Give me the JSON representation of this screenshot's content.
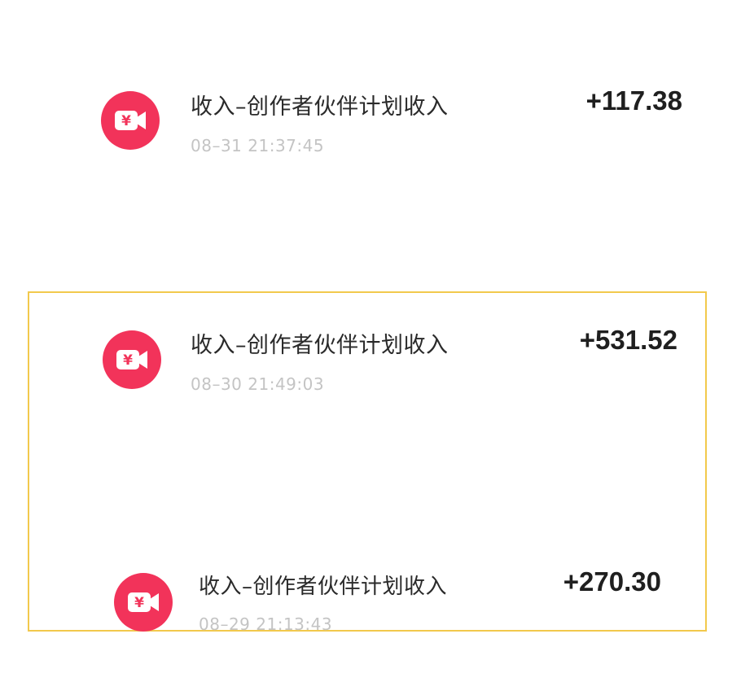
{
  "transactions": [
    {
      "title": "收入–创作者伙伴计划收入",
      "time": "08–31 21:37:45",
      "amount": "+117.38",
      "icon": "yuan-video-icon"
    },
    {
      "title": "收入–创作者伙伴计划收入",
      "time": "08–30 21:49:03",
      "amount": "+531.52",
      "icon": "yuan-video-icon"
    },
    {
      "title": "收入–创作者伙伴计划收入",
      "time": "08–29 21:13:43",
      "amount": "+270.30",
      "icon": "yuan-video-icon"
    }
  ],
  "colors": {
    "icon_background": "#f2335a",
    "highlight_border": "#f2c94c",
    "title_text": "#2a2a2a",
    "time_text": "#c4c4c4"
  }
}
